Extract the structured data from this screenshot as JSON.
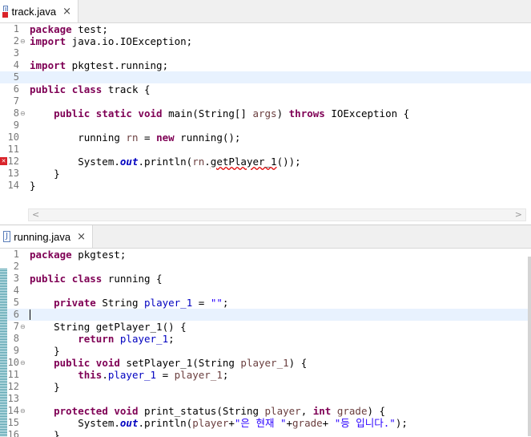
{
  "top_tab": {
    "label": "track.java",
    "icon": "java-file-error-icon",
    "close": "×"
  },
  "bottom_tab": {
    "label": "running.java",
    "icon": "java-file-icon",
    "close": "×"
  },
  "top_lines": [
    {
      "n": "1",
      "fold": "",
      "html": "<span class=\"kw\">package</span> test;"
    },
    {
      "n": "2",
      "fold": "⊖",
      "html": "<span class=\"kw\">import</span> java.io.IOException;"
    },
    {
      "n": "3",
      "fold": "",
      "html": ""
    },
    {
      "n": "4",
      "fold": "",
      "html": "<span class=\"kw\">import</span> pkgtest.running;"
    },
    {
      "n": "5",
      "fold": "",
      "html": "",
      "hl": true
    },
    {
      "n": "6",
      "fold": "",
      "html": "<span class=\"kw\">public</span> <span class=\"kw\">class</span> track {"
    },
    {
      "n": "7",
      "fold": "",
      "html": ""
    },
    {
      "n": "8",
      "fold": "⊖",
      "html": "    <span class=\"kw\">public</span> <span class=\"kw\">static</span> <span class=\"kw\">void</span> main(String[] <span class=\"prm\">args</span>) <span class=\"kw\">throws</span> IOException {"
    },
    {
      "n": "9",
      "fold": "",
      "html": ""
    },
    {
      "n": "10",
      "fold": "",
      "html": "        running <span class=\"prm\">rn</span> = <span class=\"kw\">new</span> running();"
    },
    {
      "n": "11",
      "fold": "",
      "html": ""
    },
    {
      "n": "12",
      "fold": "",
      "html": "        System.<span class=\"stat\">out</span>.println(<span class=\"prm\">rn</span>.<span class=\"squig\">getPlayer_1</span>());",
      "err": true
    },
    {
      "n": "13",
      "fold": "",
      "html": "    }"
    },
    {
      "n": "14",
      "fold": "",
      "html": "}"
    }
  ],
  "bottom_lines": [
    {
      "n": "1",
      "fold": "",
      "html": "<span class=\"kw\">package</span> pkgtest;"
    },
    {
      "n": "2",
      "fold": "",
      "html": ""
    },
    {
      "n": "3",
      "fold": "",
      "html": "<span class=\"kw\">public</span> <span class=\"kw\">class</span> running {"
    },
    {
      "n": "4",
      "fold": "",
      "html": ""
    },
    {
      "n": "5",
      "fold": "",
      "html": "    <span class=\"kw\">private</span> String <span class=\"fld\">player_1</span> = <span class=\"str\">\"\"</span>;"
    },
    {
      "n": "6",
      "fold": "",
      "html": "",
      "hl": true,
      "caret": true
    },
    {
      "n": "7",
      "fold": "⊖",
      "html": "    String getPlayer_1() {"
    },
    {
      "n": "8",
      "fold": "",
      "html": "        <span class=\"kw\">return</span> <span class=\"fld\">player_1</span>;"
    },
    {
      "n": "9",
      "fold": "",
      "html": "    }"
    },
    {
      "n": "10",
      "fold": "⊖",
      "html": "    <span class=\"kw\">public</span> <span class=\"kw\">void</span> setPlayer_1(String <span class=\"prm\">player_1</span>) {"
    },
    {
      "n": "11",
      "fold": "",
      "html": "        <span class=\"kw\">this</span>.<span class=\"fld\">player_1</span> = <span class=\"prm\">player_1</span>;"
    },
    {
      "n": "12",
      "fold": "",
      "html": "    }"
    },
    {
      "n": "13",
      "fold": "",
      "html": ""
    },
    {
      "n": "14",
      "fold": "⊖",
      "html": "    <span class=\"kw\">protected</span> <span class=\"kw\">void</span> print_status(String <span class=\"prm\">player</span>, <span class=\"kw\">int</span> <span class=\"prm\">grade</span>) {"
    },
    {
      "n": "15",
      "fold": "",
      "html": "        System.<span class=\"stat\">out</span>.println(<span class=\"prm\">player</span>+<span class=\"str\">\"은 현재 \"</span>+<span class=\"prm\">grade</span>+ <span class=\"str\">\"등 입니다.\"</span>);"
    },
    {
      "n": "16",
      "fold": "",
      "html": "    }"
    }
  ],
  "scroll_left": "<",
  "scroll_right": ">"
}
